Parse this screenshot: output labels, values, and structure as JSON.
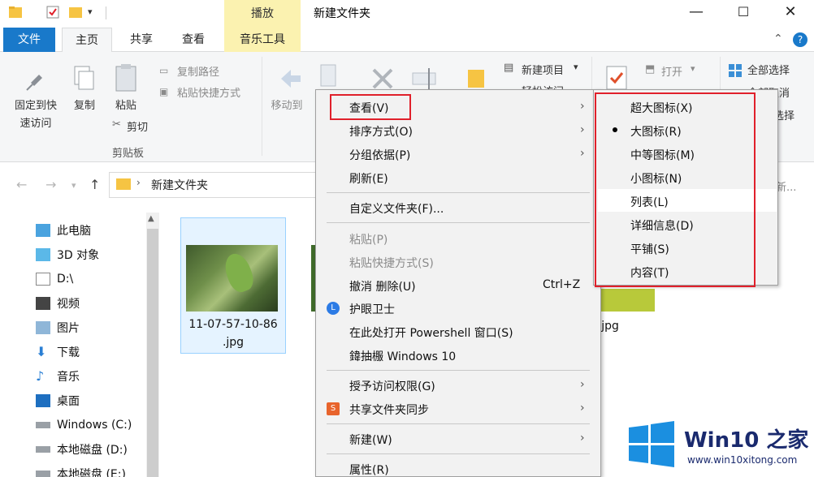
{
  "window": {
    "context_tab_group": "播放",
    "title": "新建文件夹",
    "minimize": "—",
    "maximize": "☐",
    "close": "✕"
  },
  "tabs": {
    "file": "文件",
    "home": "主页",
    "share": "共享",
    "view": "查看",
    "music_tools": "音乐工具",
    "expand_glyph": "⌃",
    "help_glyph": "?"
  },
  "ribbon": {
    "pin_quick_access": [
      "固定到快",
      "速访问"
    ],
    "copy": "复制",
    "paste": "粘贴",
    "copy_path": "复制路径",
    "paste_shortcut": "粘贴快捷方式",
    "cut": "剪切",
    "clipboard_group": "剪贴板",
    "move_to": "移动到",
    "new_item": "新建项目",
    "easy_access": "轻松访问",
    "open": "打开",
    "select_all": "全部选择",
    "select_none": "全部取消",
    "invert_fragment": "选择"
  },
  "address": {
    "path": "新建文件夹",
    "search_fragment": "新..."
  },
  "nav": {
    "items": [
      "此电脑",
      "3D 对象",
      "D:\\",
      "视频",
      "图片",
      "下载",
      "音乐",
      "桌面",
      "Windows (C:)",
      "本地磁盘 (D:)",
      "本地磁盘 (E:)"
    ]
  },
  "files": {
    "file1_line1": "11-07-57-10-86",
    "file1_line2": ".jpg",
    "file3_fragment": "ng.jpg"
  },
  "context_menu": {
    "view": "查看(V)",
    "sort": "排序方式(O)",
    "group": "分组依据(P)",
    "refresh": "刷新(E)",
    "customize": "自定义文件夹(F)...",
    "paste": "粘贴(P)",
    "paste_shortcut": "粘贴快捷方式(S)",
    "undo": "撤消 删除(U)",
    "undo_shortcut": "Ctrl+Z",
    "eye_guard": "护眼卫士",
    "powershell": "在此处打开 Powershell 窗口(S)",
    "win10": "鍏抽棴 Windows 10",
    "grant_access": "授予访问权限(G)",
    "share_sync": "共享文件夹同步",
    "new": "新建(W)",
    "properties": "属性(R)"
  },
  "submenu": {
    "extra_large": "超大图标(X)",
    "large": "大图标(R)",
    "medium": "中等图标(M)",
    "small": "小图标(N)",
    "list": "列表(L)",
    "details": "详细信息(D)",
    "tiles": "平铺(S)",
    "content": "内容(T)"
  },
  "watermark": {
    "title": "Win10 之家",
    "url": "www.win10xitong.com"
  },
  "colors": {
    "file_tab": "#1979ca",
    "context_tab": "#fbf2b0",
    "highlight_red": "#e0202b",
    "menu_bg": "#f2f2f2",
    "win_logo": "#1b8fe0"
  }
}
